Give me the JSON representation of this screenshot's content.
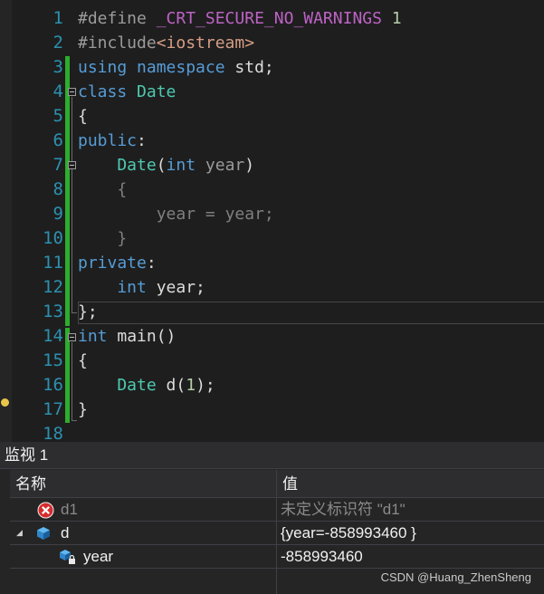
{
  "editor": {
    "line_numbers": [
      "1",
      "2",
      "3",
      "4",
      "5",
      "6",
      "7",
      "8",
      "9",
      "10",
      "11",
      "12",
      "13",
      "14",
      "15",
      "16",
      "17",
      "18"
    ],
    "l1": {
      "a": "#define ",
      "b": "_CRT_SECURE_NO_WARNINGS",
      "c": " 1"
    },
    "l2": {
      "a": "#include",
      "b": "<iostream>"
    },
    "l3": {
      "a": "using",
      "b": " namespace",
      "c": " std;"
    },
    "l4": {
      "a": "class",
      "b": " Date"
    },
    "l5": {
      "a": "{"
    },
    "l6": {
      "a": "public",
      "b": ":"
    },
    "l7": {
      "a": "    Date",
      "b": "(",
      "c": "int",
      "d": " year",
      "e": ")"
    },
    "l8": {
      "a": "    {"
    },
    "l9": {
      "a": "        year",
      "b": " = ",
      "c": "year",
      "d": ";"
    },
    "l10": {
      "a": "    }"
    },
    "l11": {
      "a": "private",
      "b": ":"
    },
    "l12": {
      "a": "    int",
      "b": " year;"
    },
    "l13": {
      "a": "};"
    },
    "l14": {
      "a": "int",
      "b": " main",
      "c": "()"
    },
    "l15": {
      "a": "{"
    },
    "l16": {
      "a": "    Date",
      "b": " d",
      "c": "(",
      "d": "1",
      "e": ");"
    },
    "l17": {
      "a": "}"
    }
  },
  "watch": {
    "title": "监视 1",
    "col_name": "名称",
    "col_value": "值",
    "rows": [
      {
        "name": "d1",
        "value": "未定义标识符 \"d1\"",
        "icon": "error-icon"
      },
      {
        "name": "d",
        "value": "{year=-858993460 }",
        "icon": "object-icon",
        "expander": "◢"
      },
      {
        "name": "year",
        "value": "-858993460",
        "icon": "private-field-icon"
      }
    ]
  },
  "watermark": "CSDN @Huang_ZhenSheng",
  "colors": {
    "background": "#1e1e1e",
    "keyword": "#569cd6",
    "type": "#4ec9b0",
    "line_number": "#2b91af",
    "change_bar": "#2cad2c"
  }
}
